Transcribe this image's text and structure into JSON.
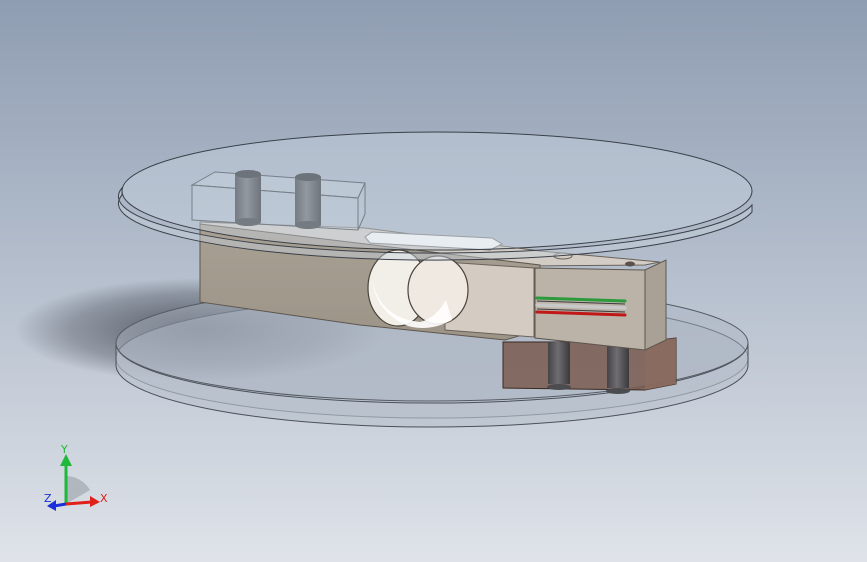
{
  "viewport": {
    "background_top": "#8f9db2",
    "background_bottom": "#dfe3e9"
  },
  "triad": {
    "x_label": "X",
    "y_label": "Y",
    "z_label": "Z",
    "x_color": "#e0201a",
    "y_color": "#1fb83a",
    "z_color": "#1a2fd8"
  },
  "model": {
    "plate_color": "#c8d3df",
    "beam_color": "#b8aea4",
    "wire_colors": [
      "#2a9a3a",
      "#c8c8c8",
      "#c01818"
    ]
  }
}
